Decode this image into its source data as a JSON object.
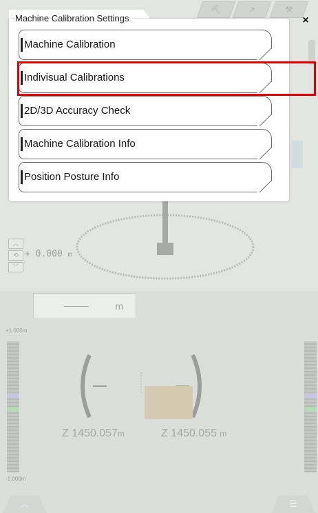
{
  "popup": {
    "title": "Machine Calibration Settings",
    "close_symbol": "×",
    "items": [
      {
        "label": "Machine Calibration"
      },
      {
        "label": "Indivisual Calibrations"
      },
      {
        "label": "2D/3D Accuracy Check"
      },
      {
        "label": "Machine Calibration Info"
      },
      {
        "label": "Position Posture Info"
      }
    ],
    "highlighted_index": 1,
    "highlight_color": "#e00000"
  },
  "background": {
    "elevation_value": "0.000",
    "elevation_unit": "m",
    "elevation_prefix": "+",
    "lower_tab_unit": "m",
    "scale_top": "+1.000m",
    "scale_bottom": "-1.000m",
    "z_left_prefix": "Z",
    "z_left_value": "1450.057",
    "z_left_unit": "m",
    "z_right_prefix": "Z",
    "z_right_value": "1450.055",
    "z_right_unit": "m",
    "bottom_left_icon": "chevron-up-icon",
    "bottom_right_icon": "menu-icon",
    "dim_color": "#e3e5e3"
  }
}
